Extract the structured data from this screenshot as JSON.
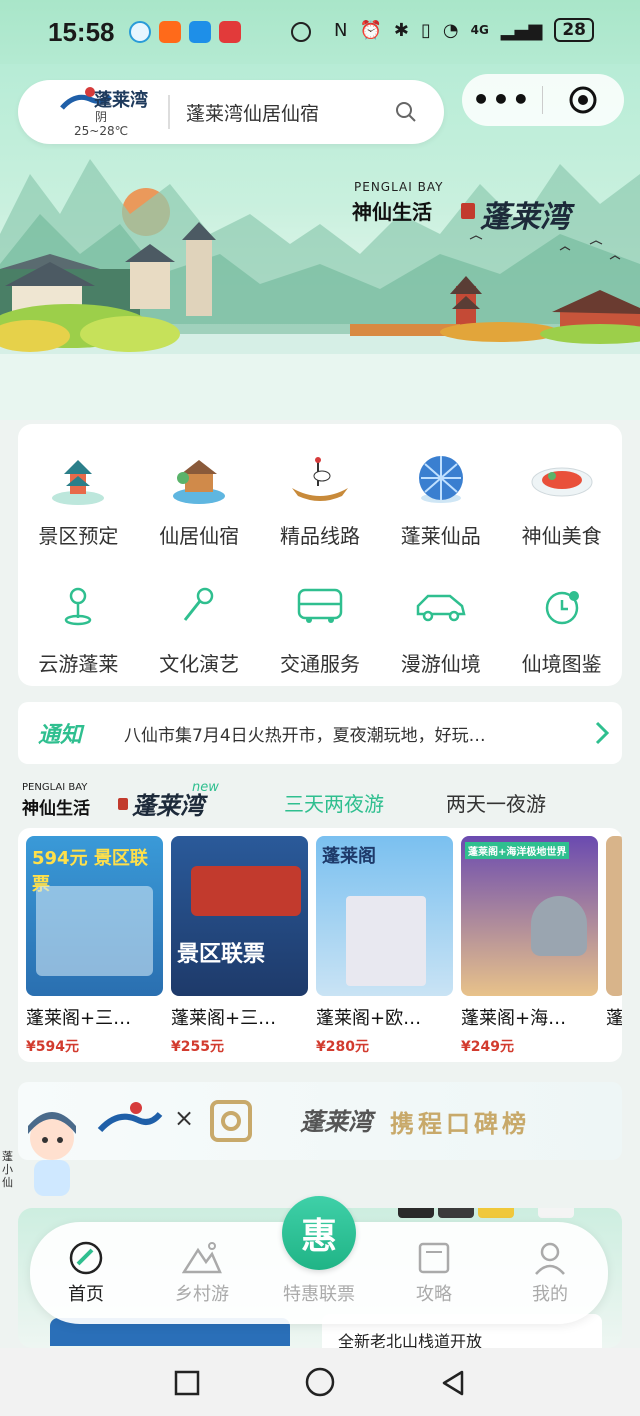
{
  "status_bar": {
    "time": "15:58",
    "battery": "28",
    "network": "4G"
  },
  "header": {
    "logo_text": "蓬莱湾",
    "weather_condition": "阴",
    "weather_temp": "25~28℃",
    "search_placeholder": "蓬莱湾仙居仙宿",
    "more_label": "•••"
  },
  "hero": {
    "brand_en": "PENGLAI BAY",
    "brand_cn": "神仙生活",
    "brand_script": "蓬莱湾"
  },
  "menu": {
    "row1": [
      {
        "label": "景区预定",
        "icon": "pagoda-icon"
      },
      {
        "label": "仙居仙宿",
        "icon": "cabin-icon"
      },
      {
        "label": "精品线路",
        "icon": "crane-boat-icon"
      },
      {
        "label": "蓬莱仙品",
        "icon": "gift-ball-icon"
      },
      {
        "label": "神仙美食",
        "icon": "food-plate-icon"
      }
    ],
    "row2": [
      {
        "label": "云游蓬莱",
        "icon": "location-pin-icon"
      },
      {
        "label": "文化演艺",
        "icon": "microphone-icon"
      },
      {
        "label": "交通服务",
        "icon": "bus-icon"
      },
      {
        "label": "漫游仙境",
        "icon": "car-icon"
      },
      {
        "label": "仙境图鉴",
        "icon": "clock-badge-icon"
      }
    ]
  },
  "notice": {
    "badge": "通知",
    "text": "八仙市集7月4日火热开市，夏夜潮玩地，好玩…"
  },
  "section": {
    "brand_en": "PENGLAI BAY",
    "brand_cn": "神仙生活",
    "brand_script": "蓬莱湾",
    "new_tag": "new",
    "tab_active": "三天两夜游",
    "tab_inactive": "两天一夜游"
  },
  "products": [
    {
      "title": "蓬莱阁+三…",
      "price": "¥594元",
      "tag": "594元 景区联票"
    },
    {
      "title": "蓬莱阁+三…",
      "price": "¥255元",
      "tag": "景区联票"
    },
    {
      "title": "蓬莱阁+欧…",
      "price": "¥280元",
      "tag": "蓬莱阁"
    },
    {
      "title": "蓬莱阁+海…",
      "price": "¥249元",
      "tag": "蓬莱阁+海洋极地世界"
    },
    {
      "title": "蓬",
      "price": "",
      "tag": ""
    }
  ],
  "collab": {
    "x": "×",
    "script": "蓬莱湾",
    "rank": "携程口碑榜",
    "ai_name": "蓬小仙"
  },
  "promo": {
    "right_text": "全新老北山栈道开放"
  },
  "tabbar": {
    "home": "首页",
    "village": "乡村游",
    "center_glyph": "惠",
    "center_label": "特惠联票",
    "guide": "攻略",
    "mine": "我的"
  },
  "colors": {
    "accent": "#2fbf8f",
    "price": "#d23b2e"
  }
}
